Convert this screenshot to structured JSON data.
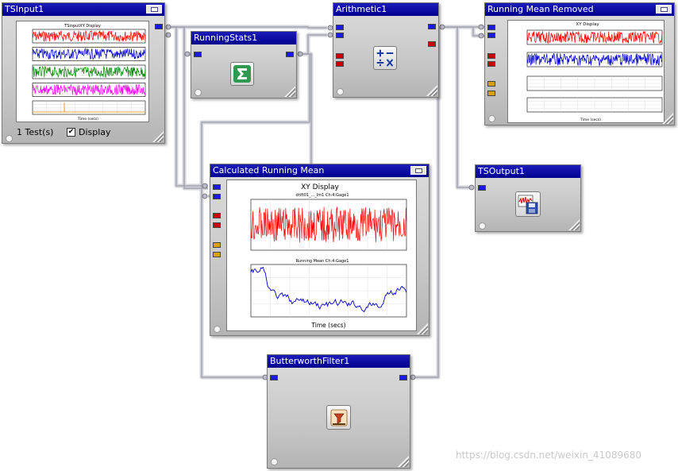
{
  "nodes": {
    "tsinput": {
      "title": "TSInput1",
      "status_text": "1 Test(s)",
      "display_checkbox_label": "Display",
      "display_checked": true,
      "plot_title": "TSinputXY Display",
      "xaxis_label": "Time (secs)"
    },
    "running_stats": {
      "title": "RunningStats1"
    },
    "arithmetic": {
      "title": "Arithmetic1"
    },
    "running_mean_removed": {
      "title": "Running Mean Removed",
      "plot_title": "XY Display",
      "xaxis_label": "Time (secs)"
    },
    "calc_running_mean": {
      "title": "Calculated Running Mean",
      "plot_title": "XY Display",
      "top_subtitle": "drift01_..._Im1 Ch:4:Gage1",
      "bottom_subtitle": "Running Mean Ch:4:Gage1",
      "xaxis_label": "Time (secs)"
    },
    "tsoutput": {
      "title": "TSOutput1"
    },
    "butterworth": {
      "title": "ButterworthFilter1"
    }
  },
  "icons": {
    "running_stats": "sigma-icon",
    "arithmetic": "arithmetic-operators-icon",
    "tsoutput": "save-to-disk-icon",
    "butterworth": "filter-icon"
  },
  "colors": {
    "titlebar": "#000090",
    "port_blue": "#1a1ae6",
    "port_red": "#cc0000",
    "port_gold": "#d8a000",
    "trace_red": "#ff0000",
    "trace_blue": "#0000cc",
    "trace_green": "#008800",
    "trace_magenta": "#ff00ff",
    "trace_orange": "#e08a00",
    "wire": "#c0c0c8"
  },
  "watermark": "https://blog.csdn.net/weixin_41089680"
}
